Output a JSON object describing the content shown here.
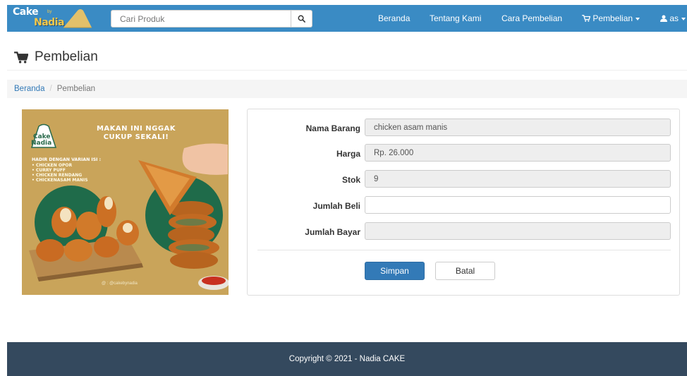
{
  "brand": {
    "logo_word1": "Cake",
    "logo_word2": "Nadia",
    "logo_tiny": "by"
  },
  "search": {
    "placeholder": "Cari Produk",
    "icon": "search-icon"
  },
  "nav": {
    "home": "Beranda",
    "about": "Tentang Kami",
    "how_to_buy": "Cara Pembelian",
    "purchase": "Pembelian",
    "user": "as"
  },
  "page": {
    "title": "Pembelian",
    "title_icon": "cart-icon"
  },
  "breadcrumb": {
    "home": "Beranda",
    "separator": "/",
    "current": "Pembelian"
  },
  "product_image": {
    "logo_word1": "Cake",
    "logo_word2": "Nadia",
    "headline_line1": "MAKAN INI NGGAK",
    "headline_line2": "CUKUP SEKALI!",
    "list_heading": "HADIR DENGAN VARIAN ISI :",
    "items": [
      "• CHICKEN OPOR",
      "• CURRY PUFF",
      "• CHICKEN RENDANG",
      "• CHICKENASAM MANIS"
    ],
    "credit": "@ : @cakebynadia"
  },
  "form": {
    "nama_barang": {
      "label": "Nama Barang",
      "value": "chicken asam manis"
    },
    "harga": {
      "label": "Harga",
      "value": "Rp. 26.000"
    },
    "stok": {
      "label": "Stok",
      "value": "9"
    },
    "jumlah_beli": {
      "label": "Jumlah Beli",
      "value": ""
    },
    "jumlah_bayar": {
      "label": "Jumlah Bayar",
      "value": ""
    },
    "save_label": "Simpan",
    "cancel_label": "Batal"
  },
  "footer": {
    "copyright": "Copyright © 2021 - Nadia CAKE"
  },
  "colors": {
    "navbar": "#3a8bc4",
    "primary": "#337ab7",
    "footer": "#34495e",
    "image_bg": "#c9a45a"
  }
}
